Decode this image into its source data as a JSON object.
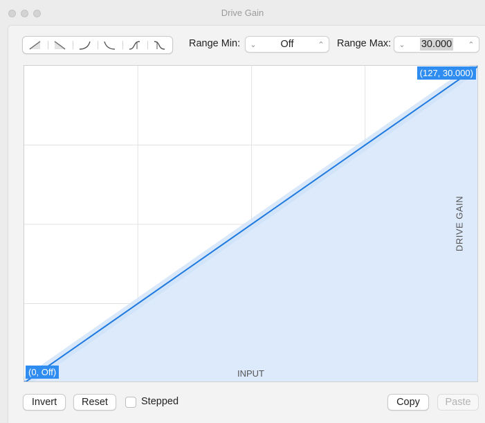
{
  "window": {
    "title": "Drive Gain"
  },
  "toolbar": {
    "curve_icons": [
      "linear-up-icon",
      "linear-down-icon",
      "convex-up-icon",
      "concave-down-icon",
      "s-curve-icon",
      "reverse-s-curve-icon"
    ],
    "range_min_label": "Range Min:",
    "range_min_value": "Off",
    "range_max_label": "Range Max:",
    "range_max_value": "30.000"
  },
  "graph": {
    "x_axis_label": "INPUT",
    "y_axis_label": "DRIVE GAIN",
    "start_point_label": "(0, Off)",
    "end_point_label": "(127, 30.000)",
    "line_color": "#1f7ae0",
    "fill_color": "#dbe9fb",
    "label_color": "#2f8cf0"
  },
  "chart_data": {
    "type": "line",
    "x": [
      0,
      127
    ],
    "y": [
      0,
      30
    ],
    "xlim": [
      0,
      127
    ],
    "ylim": [
      0,
      30
    ],
    "grid": true
  },
  "footer": {
    "invert_label": "Invert",
    "reset_label": "Reset",
    "stepped_label": "Stepped",
    "stepped_checked": false,
    "copy_label": "Copy",
    "paste_label": "Paste"
  }
}
